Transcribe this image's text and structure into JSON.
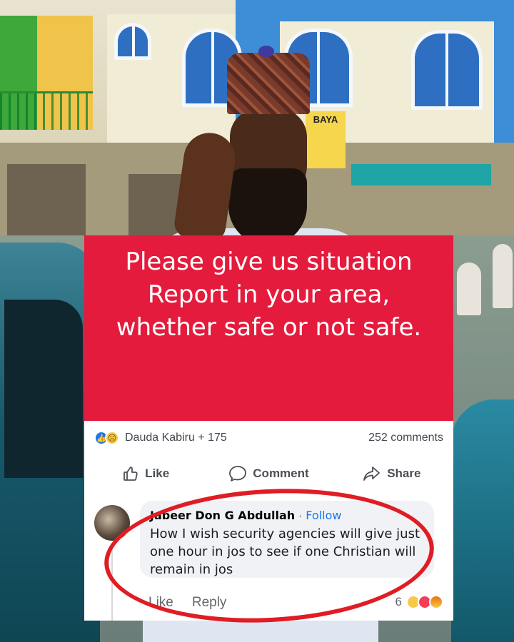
{
  "background": {
    "shop_sign": "BAYA"
  },
  "banner": {
    "text": "Please give us situation Report in your area, whether safe or not safe.",
    "color": "#e41b3c"
  },
  "post_stats": {
    "reaction_icons": [
      "like-icon",
      "sad-icon"
    ],
    "reactors": "Dauda Kabiru + 175",
    "comments": "252 comments"
  },
  "actions": {
    "like": "Like",
    "comment": "Comment",
    "share": "Share"
  },
  "comment": {
    "author": "Jabeer Don G Abdullah",
    "separator": "·",
    "follow": "Follow",
    "text": "How I wish security agencies will give just one hour in jos to see if one Christian will remain in jos",
    "like": "Like",
    "reply": "Reply",
    "reaction_count": "6",
    "reaction_icons": [
      "haha-icon",
      "love-icon",
      "angry-icon"
    ]
  },
  "colors": {
    "facebook_blue": "#1877f2",
    "highlight_circle": "#e01c24"
  }
}
